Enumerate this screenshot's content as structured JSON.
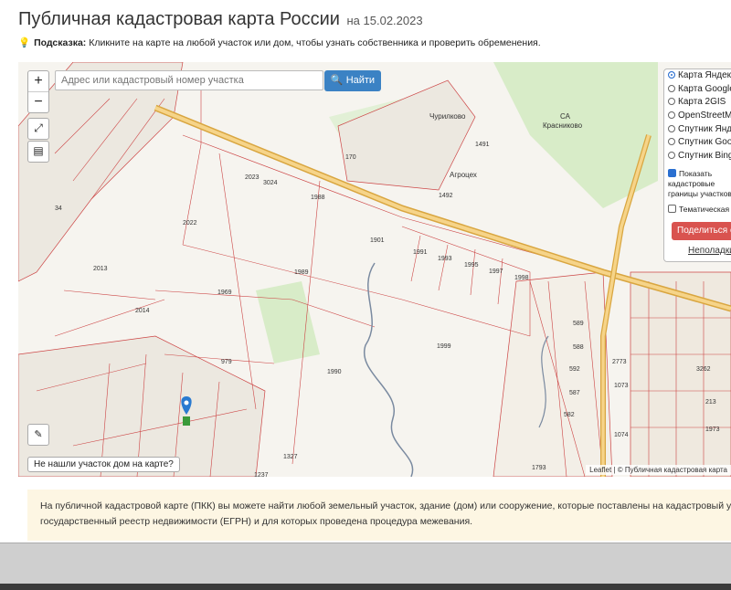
{
  "header": {
    "title": "Публичная кадастровая карта России",
    "date": "на 15.02.2023"
  },
  "hint": {
    "label": "Подсказка:",
    "text": "Кликните на карте на любой участок или дом, чтобы узнать собственника и проверить обременения."
  },
  "map": {
    "zoom_in": "+",
    "zoom_out": "−",
    "search": {
      "placeholder": "Адрес или кадастровый номер участка",
      "value": ""
    },
    "find_button": "Найти",
    "layers": [
      {
        "label": "Карта Яндекс",
        "selected": true
      },
      {
        "label": "Карта Google",
        "selected": false
      },
      {
        "label": "Карта 2GIS",
        "selected": false
      },
      {
        "label": "OpenStreetMap",
        "selected": false
      },
      {
        "label": "Спутник Яндекс",
        "selected": false
      },
      {
        "label": "Спутник Google",
        "selected": false
      },
      {
        "label": "Спутник Bing",
        "selected": false
      }
    ],
    "checkboxes": [
      {
        "label": "Показать кадастровые границы участков",
        "checked": true
      },
      {
        "label": "Тематическая карта",
        "checked": false
      }
    ],
    "share_button": "Поделиться ссылкой",
    "report_link": "Неполадки карты",
    "not_found_button": "Не нашли участок дом на карте?",
    "attribution": "Leaflet | © Публичная кадастровая карта",
    "place_labels": {
      "churilkovo": "Чурилково",
      "agrocex": "Агроцех",
      "krasnikovo": "Красниково",
      "sa": "СА"
    },
    "parcel_numbers": [
      "1988",
      "1901",
      "2022",
      "2013",
      "1989",
      "1969",
      "2014",
      "1999",
      "979",
      "1990",
      "1237",
      "1327",
      "170",
      "1491",
      "1492",
      "34",
      "2023",
      "3024",
      "1991",
      "1993",
      "1995",
      "1997",
      "1998",
      "589",
      "588",
      "592",
      "587",
      "582",
      "2773",
      "1073",
      "1074",
      "3262",
      "213",
      "1973",
      "1793"
    ]
  },
  "info": {
    "line1": "На публичной кадастровой карте (ПКК) вы можете найти любой земельный участок, здание (дом) или сооружение, которые поставлены на кадастровый учёт в",
    "line2": "государственный реестр недвижимости (ЕГРН) и для которых проведена процедура межевания."
  },
  "colors": {
    "accent": "#3b82c4",
    "danger": "#d9534f",
    "road": "#f0c060",
    "parcel": "#c44"
  }
}
